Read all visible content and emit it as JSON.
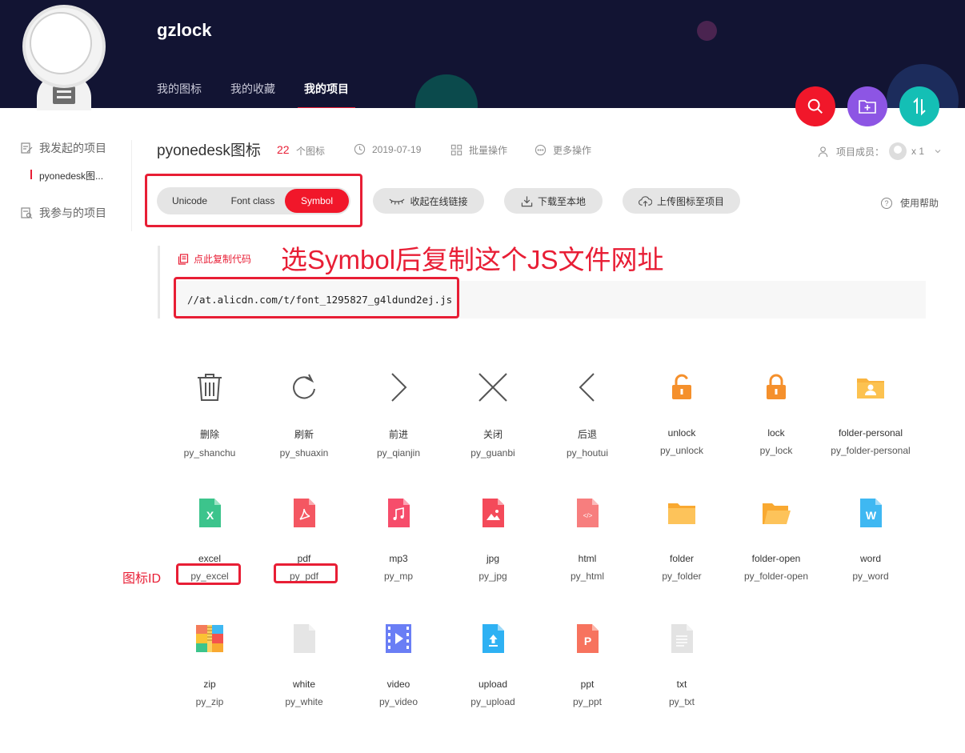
{
  "header": {
    "brand": "gzlock",
    "nav": [
      {
        "label": "我的图标",
        "active": false
      },
      {
        "label": "我的收藏",
        "active": false
      },
      {
        "label": "我的项目",
        "active": true
      }
    ],
    "fabs": [
      {
        "name": "search",
        "color": "#f1172a"
      },
      {
        "name": "new-folder",
        "color": "#8d55e4"
      },
      {
        "name": "sort",
        "color": "#14bfb5"
      }
    ]
  },
  "sidebar": {
    "initiated_label": "我发起的项目",
    "project_item": "pyonedesk图...",
    "joined_label": "我参与的项目"
  },
  "project": {
    "title": "pyonedesk图标",
    "count": "22",
    "count_label": "个图标",
    "date": "2019-07-19",
    "batch_label": "批量操作",
    "more_label": "更多操作",
    "members_label": "项目成员：",
    "members_count": "x 1"
  },
  "toolbar": {
    "segments": [
      "Unicode",
      "Font class",
      "Symbol"
    ],
    "active_segment": "Symbol",
    "collapse_label": "收起在线链接",
    "download_label": "下载至本地",
    "upload_label": "上传图标至项目",
    "help_label": "使用帮助"
  },
  "code": {
    "copy_label": "点此复制代码",
    "url": "//at.alicdn.com/t/font_1295827_g4ldund2ej.js"
  },
  "annotations": {
    "caption": "选Symbol后复制这个JS文件网址",
    "id_label": "图标ID"
  },
  "icons": [
    {
      "name": "删除",
      "id": "py_shanchu",
      "icon": "trash-icon"
    },
    {
      "name": "刷新",
      "id": "py_shuaxin",
      "icon": "refresh-icon"
    },
    {
      "name": "前进",
      "id": "py_qianjin",
      "icon": "chevron-right-icon"
    },
    {
      "name": "关闭",
      "id": "py_guanbi",
      "icon": "close-icon"
    },
    {
      "name": "后退",
      "id": "py_houtui",
      "icon": "chevron-left-icon"
    },
    {
      "name": "unlock",
      "id": "py_unlock",
      "icon": "unlock-icon"
    },
    {
      "name": "lock",
      "id": "py_lock",
      "icon": "lock-icon"
    },
    {
      "name": "folder-personal",
      "id": "py_folder-personal",
      "icon": "folder-personal-icon"
    },
    {
      "name": "excel",
      "id": "py_excel",
      "icon": "excel-file-icon"
    },
    {
      "name": "pdf",
      "id": "py_pdf",
      "icon": "pdf-file-icon"
    },
    {
      "name": "mp3",
      "id": "py_mp",
      "icon": "mp3-file-icon"
    },
    {
      "name": "jpg",
      "id": "py_jpg",
      "icon": "jpg-file-icon"
    },
    {
      "name": "html",
      "id": "py_html",
      "icon": "html-file-icon"
    },
    {
      "name": "folder",
      "id": "py_folder",
      "icon": "folder-icon"
    },
    {
      "name": "folder-open",
      "id": "py_folder-open",
      "icon": "folder-open-icon"
    },
    {
      "name": "word",
      "id": "py_word",
      "icon": "word-file-icon"
    },
    {
      "name": "zip",
      "id": "py_zip",
      "icon": "zip-file-icon"
    },
    {
      "name": "white",
      "id": "py_white",
      "icon": "blank-file-icon"
    },
    {
      "name": "video",
      "id": "py_video",
      "icon": "video-file-icon"
    },
    {
      "name": "upload",
      "id": "py_upload",
      "icon": "upload-file-icon"
    },
    {
      "name": "ppt",
      "id": "py_ppt",
      "icon": "ppt-file-icon"
    },
    {
      "name": "txt",
      "id": "py_txt",
      "icon": "txt-file-icon"
    }
  ],
  "colors": {
    "header_bg": "#121433",
    "accent": "#e81e35",
    "symbol_active": "#f1172a"
  }
}
